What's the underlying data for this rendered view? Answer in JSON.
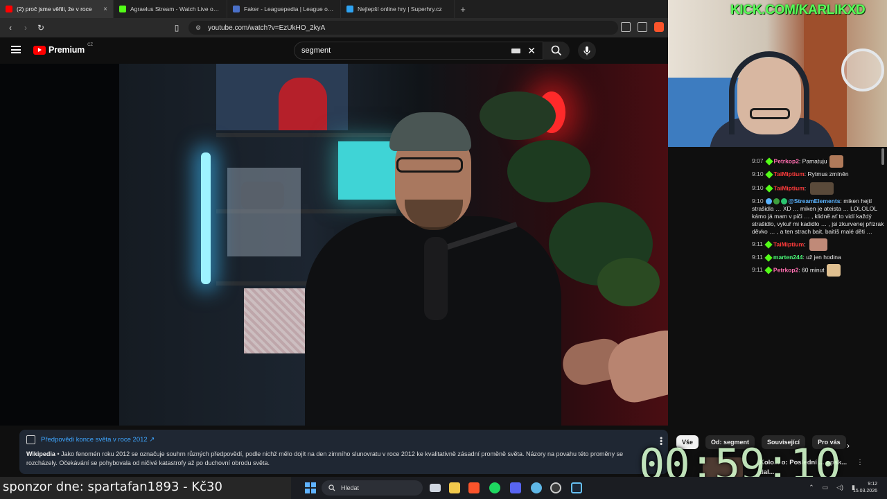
{
  "browser": {
    "tabs": [
      {
        "label": "(2) proč jsme věřili, že v roce",
        "favicon": "youtube",
        "color": "#ff0000",
        "active": true
      },
      {
        "label": "Agraelus Stream - Watch Live on Kick",
        "favicon": "kick",
        "color": "#53fc18",
        "active": false
      },
      {
        "label": "Faker - Leaguepedia | League of Lege",
        "favicon": "leaguepedia",
        "color": "#4a70c8",
        "active": false
      },
      {
        "label": "Nejlepší online hry | Superhry.cz",
        "favicon": "superhry",
        "color": "#2ea3f2",
        "active": false
      }
    ],
    "close_icon": "×",
    "newtab_icon": "+",
    "url": "youtube.com/watch?v=EzUkHO_2kyA"
  },
  "youtube": {
    "logo_text": "Premium",
    "logo_region": "CZ",
    "search_value": "segment",
    "knowledge_panel": {
      "title": "Předpovědi konce světa v roce 2012 ↗",
      "source": "Wikipedia",
      "text": " • Jako fenomén roku 2012 se označuje souhrn různých předpovědí, podle nichž mělo dojít na den zimního slunovratu v roce 2012 ke kvalitativně zásadní proměně světa. Názory na povahu této proměny se rozcházely. Očekávání se pohybovala od ničivé katastrofy až po duchovní obrodu světa."
    },
    "chips": [
      "Vše",
      "Od: segment",
      "Související",
      "Pro vás"
    ],
    "recommendation_title": "Kolo... o: Poslední ... opsk...",
    "recommendation_line2": "dal..."
  },
  "stream_overlay": {
    "kick_banner": "KICK.COM/KARLIKXD",
    "timer": "00:59:10",
    "sponsor": "sponzor dne: spartafan1893 - Kč30"
  },
  "chat": [
    {
      "time": "9:07",
      "user": "Petrkop2",
      "user_color": "u-pink",
      "message": "Pamatuju",
      "emote": "#b07a5a"
    },
    {
      "time": "9:10",
      "user": "TaiMiptium",
      "user_color": "u-red",
      "message": "Rytmus zmíněn",
      "emote": ""
    },
    {
      "time": "9:10",
      "user": "TaiMiptium",
      "user_color": "u-red",
      "message": "",
      "emote": "#5a4a3a"
    },
    {
      "time": "9:10",
      "user": "@StreamElements",
      "user_color": "u-blue",
      "message": "miken hejtí strašidla … XD … miken je ateista … LOLOLOL kámo já mam v piči … , klidně ať to vidí každý strašidlo, vykuř mi kadidlo … , jsi zkurvenej přízrak děvko … , a ten strach bait, baitíš malé děti …",
      "emote": ""
    },
    {
      "time": "9:11",
      "user": "TaiMiptium",
      "user_color": "u-red",
      "message": "",
      "emote": "#c08a78"
    },
    {
      "time": "9:11",
      "user": "marten244",
      "user_color": "u-green",
      "message": "už jen hodina",
      "emote": ""
    },
    {
      "time": "9:11",
      "user": "Petrkop2",
      "user_color": "u-pink",
      "message": "60 minut",
      "emote": "#e0c090"
    }
  ],
  "taskbar": {
    "search_placeholder": "Hledat",
    "time": "9:12",
    "date": "15.03.2026"
  }
}
